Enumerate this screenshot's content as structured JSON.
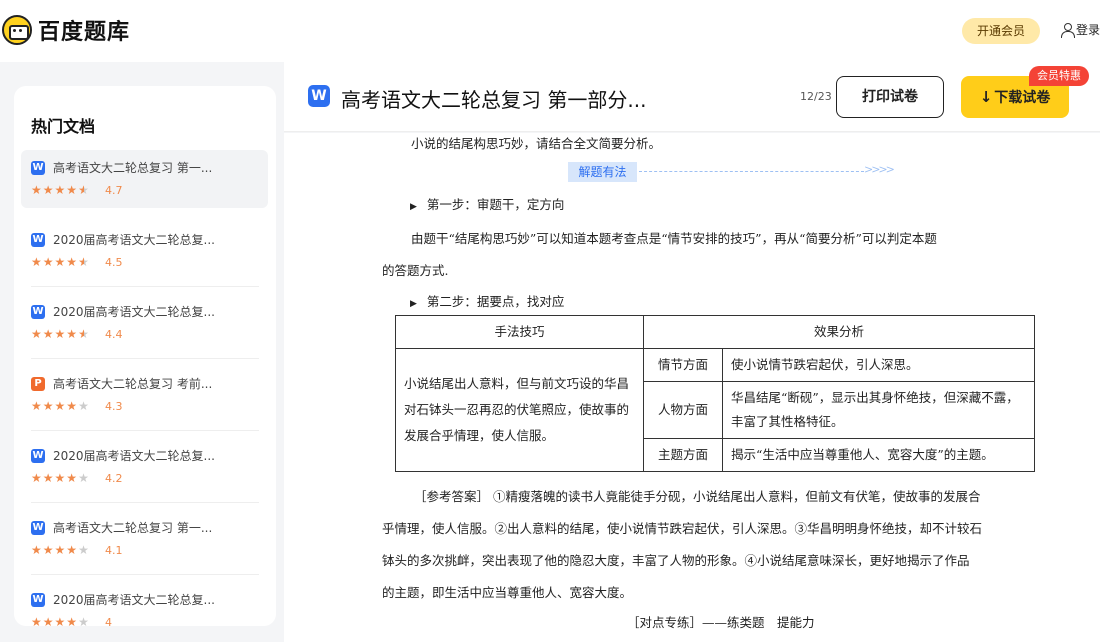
{
  "header": {
    "brand": "百度题库",
    "vip_label": "开通会员",
    "login_label": "登录"
  },
  "sidebar": {
    "title": "热门文档",
    "items": [
      {
        "type": "W",
        "title": "高考语文大二轮总复习 第一...",
        "stars": 4.5,
        "score": "4.7"
      },
      {
        "type": "W",
        "title": "2020届高考语文大二轮总复...",
        "stars": 4.5,
        "score": "4.5"
      },
      {
        "type": "W",
        "title": "2020届高考语文大二轮总复...",
        "stars": 4.5,
        "score": "4.4"
      },
      {
        "type": "P",
        "title": "高考语文大二轮总复习 考前...",
        "stars": 4,
        "score": "4.3"
      },
      {
        "type": "W",
        "title": "2020届高考语文大二轮总复...",
        "stars": 4,
        "score": "4.2"
      },
      {
        "type": "W",
        "title": "高考语文大二轮总复习 第一...",
        "stars": 4,
        "score": "4.1"
      },
      {
        "type": "W",
        "title": "2020届高考语文大二轮总复...",
        "stars": 4,
        "score": "4"
      }
    ]
  },
  "doc": {
    "icon_letter": "W",
    "title": "高考语文大二轮总复习 第一部分...",
    "page_count": "12/23",
    "print_label": "打印试卷",
    "download_label": "下载试卷",
    "promo_label": "会员特惠",
    "content": {
      "line0": "小说的结尾构思巧妙，请结合全文简要分析。",
      "tag": "解题有法",
      "arrows": ">>>>",
      "step1": "第一步：审题干，定方向",
      "para1a": "由题干“结尾构思巧妙”可以知道本题考查点是“情节安排的技巧”，再从“简要分析”可以判定本题",
      "para1b": "的答题方式.",
      "step2": "第二步：据要点，找对应",
      "table": {
        "h1": "手法技巧",
        "h2": "效果分析",
        "left": "小说结尾出人意料，但与前文巧设的华昌对石钵头一忍再忍的伏笔照应，使故事的发展合乎情理，使人信服。",
        "rows": [
          {
            "aspect": "情节方面",
            "effect": "使小说情节跌宕起伏，引人深思。"
          },
          {
            "aspect": "人物方面",
            "effect": "华昌结尾“断砚”，显示出其身怀绝技，但深藏不露，丰富了其性格特征。"
          },
          {
            "aspect": "主题方面",
            "effect": "揭示“生活中应当尊重他人、宽容大度”的主题。"
          }
        ]
      },
      "ans1": "［参考答案］ ①精瘦落魄的读书人竟能徒手分砚，小说结尾出人意料，但前文有伏笔，使故事的发展合",
      "ans2": "乎情理，使人信服。②出人意料的结尾，使小说情节跌宕起伏，引人深思。③华昌明明身怀绝技，却不计较石",
      "ans3": "钵头的多次挑衅，突出表现了他的隐忍大度，丰富了人物的形象。④小说结尾意味深长，更好地揭示了作品",
      "ans4": "的主题，即生活中应当尊重他人、宽容大度。",
      "section": "［对点专练］——练类题　提能力"
    }
  }
}
